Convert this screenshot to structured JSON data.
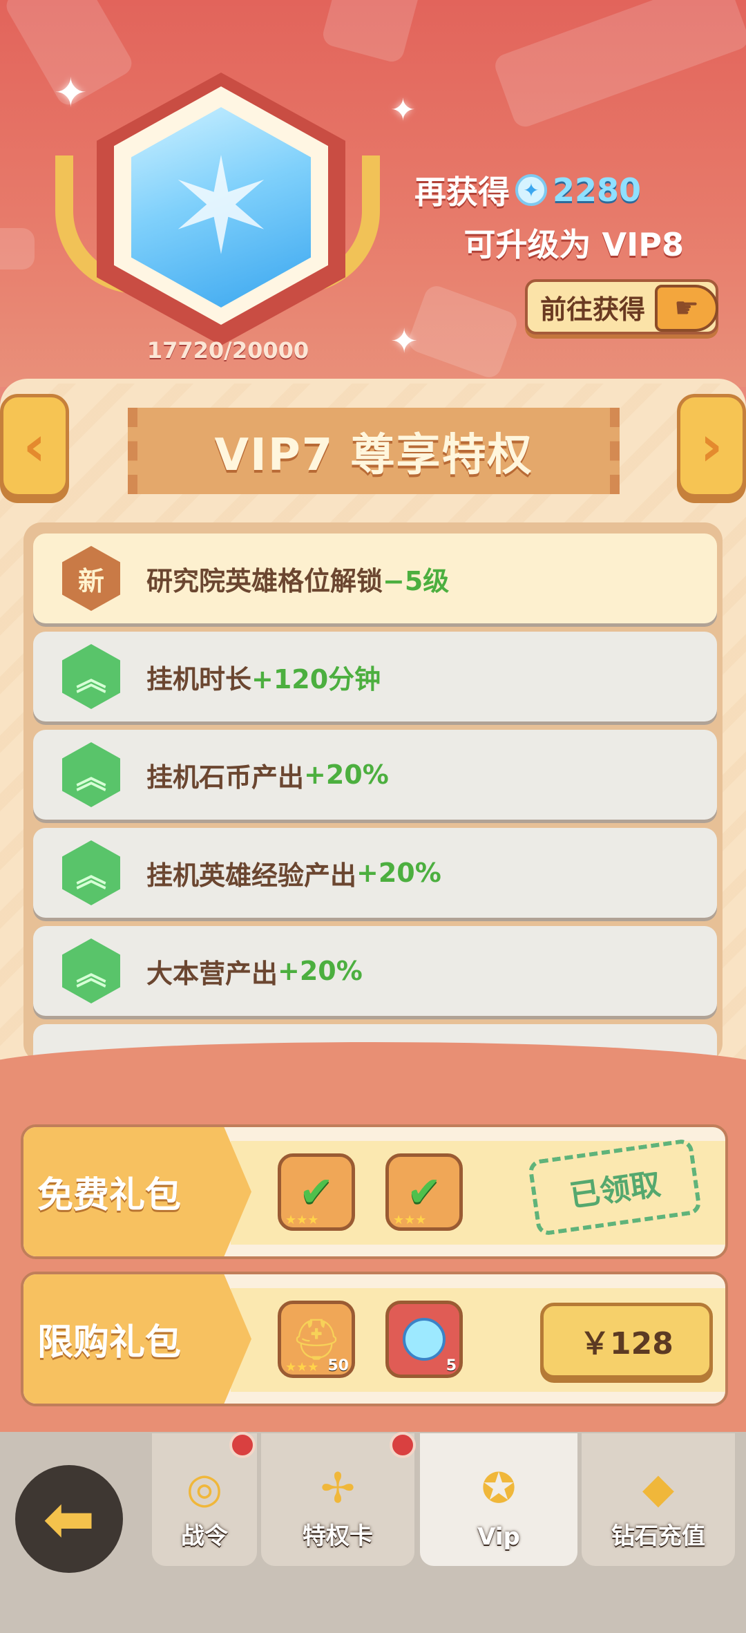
{
  "header": {
    "progress": "17720/20000",
    "need_prefix": "再获得",
    "need_amount": "2280",
    "upgrade_text": "可升级为 VIP8",
    "goto_label": "前往获得",
    "diamond_icon": "diamond-icon"
  },
  "panel": {
    "title": "VIP7 尊享特权",
    "prev_arrow": "‹",
    "next_arrow": "›"
  },
  "privileges": [
    {
      "badge": "新",
      "text": "研究院英雄格位解锁",
      "value": "−5级",
      "icon": "new-badge-icon"
    },
    {
      "badge": "︽",
      "text": "挂机时长",
      "value": "+120分钟",
      "icon": "upgrade-icon"
    },
    {
      "badge": "︽",
      "text": "挂机石币产出",
      "value": "+20%",
      "icon": "upgrade-icon"
    },
    {
      "badge": "︽",
      "text": "挂机英雄经验产出",
      "value": "+20%",
      "icon": "upgrade-icon"
    },
    {
      "badge": "︽",
      "text": "大本营产出",
      "value": "+20%",
      "icon": "upgrade-icon"
    }
  ],
  "gifts": {
    "free": {
      "label": "免费礼包",
      "status": "已领取"
    },
    "limited": {
      "label": "限购礼包",
      "price": "￥128",
      "item1_qty": "50",
      "item2_qty": "5"
    }
  },
  "nav": {
    "tabs": [
      {
        "label": "战令",
        "icon": "battle-pass-icon"
      },
      {
        "label": "特权卡",
        "icon": "privilege-card-icon"
      },
      {
        "label": "Vip",
        "icon": "vip-icon"
      },
      {
        "label": "钻石充值",
        "icon": "diamond-recharge-icon"
      }
    ],
    "back_icon": "back-arrow-icon"
  },
  "colors": {
    "accent": "#f6c453",
    "green": "#4caf3f",
    "header_red": "#e2645b"
  }
}
